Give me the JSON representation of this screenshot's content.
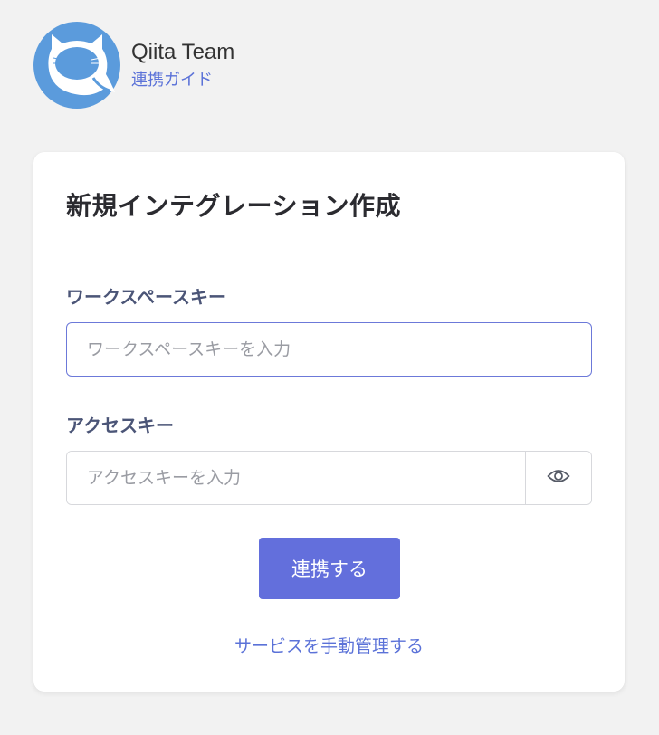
{
  "header": {
    "app_name": "Qiita Team",
    "guide_link": "連携ガイド",
    "logo_icon": "qiita-cat-logo"
  },
  "form": {
    "title": "新規インテグレーション作成",
    "workspace_key": {
      "label": "ワークスペースキー",
      "placeholder": "ワークスペースキーを入力",
      "value": ""
    },
    "access_key": {
      "label": "アクセスキー",
      "placeholder": "アクセスキーを入力",
      "value": "",
      "toggle_icon": "eye-icon"
    },
    "submit_label": "連携する",
    "manual_link": "サービスを手動管理する"
  },
  "colors": {
    "background": "#f2f2f2",
    "logo": "#5b9bdc",
    "primary_button": "#636fdc",
    "link": "#5b72d8",
    "label": "#4b5577"
  }
}
